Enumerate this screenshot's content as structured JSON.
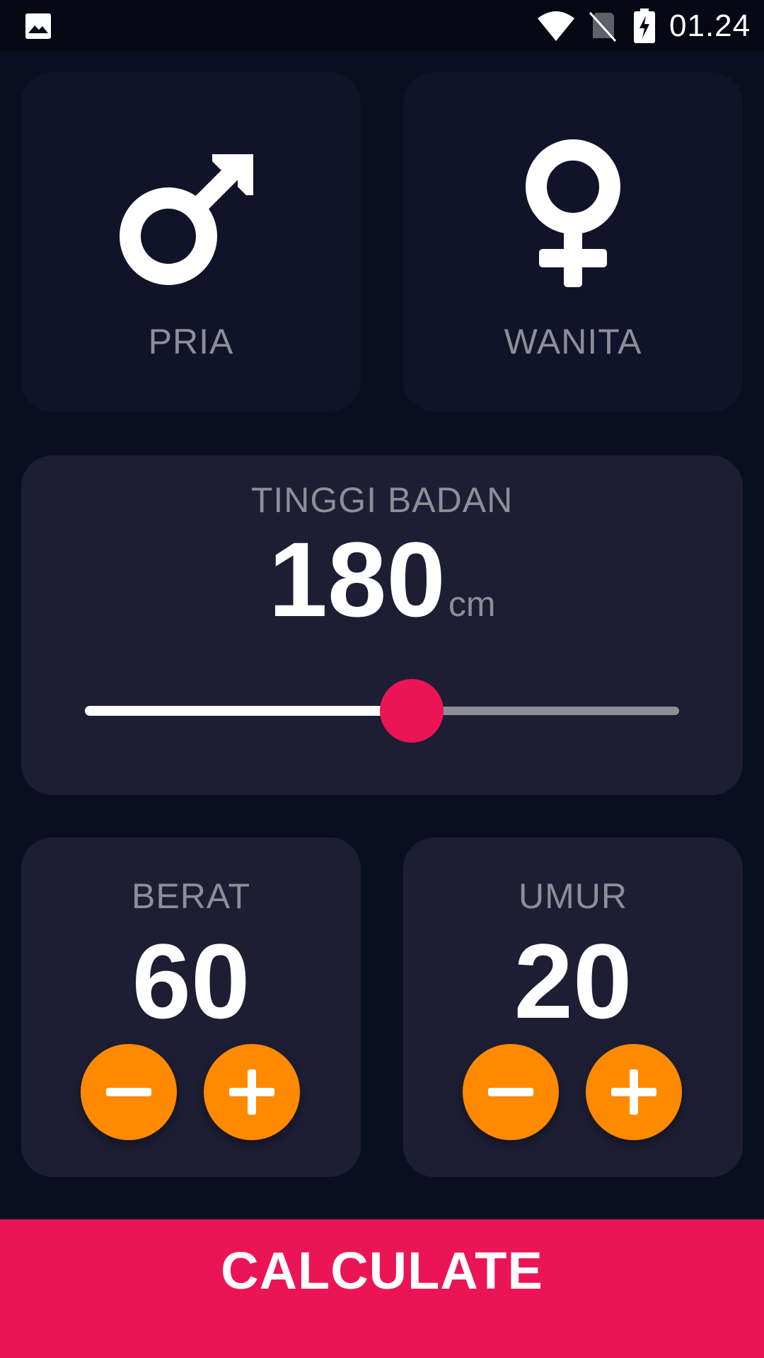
{
  "status_bar": {
    "time": "01.24",
    "icons": [
      "gallery-icon",
      "wifi-icon",
      "no-sim-icon",
      "battery-charging-icon"
    ]
  },
  "gender": {
    "male": {
      "label": "PRIA",
      "icon": "male-symbol-icon"
    },
    "female": {
      "label": "WANITA",
      "icon": "female-symbol-icon"
    }
  },
  "height": {
    "title": "TINGGI BADAN",
    "value": "180",
    "unit": "cm",
    "slider_fraction": 0.55
  },
  "weight": {
    "title": "BERAT",
    "value": "60",
    "minus_icon": "minus-icon",
    "plus_icon": "plus-icon"
  },
  "age": {
    "title": "UMUR",
    "value": "20",
    "minus_icon": "minus-icon",
    "plus_icon": "plus-icon"
  },
  "calculate": {
    "label": "CALCULATE"
  },
  "colors": {
    "background": "#0a0e21",
    "inactive_card": "#111328",
    "active_card": "#1d1e33",
    "accent": "#eb1555",
    "button": "#ff8a00",
    "label": "#8d8e98"
  }
}
